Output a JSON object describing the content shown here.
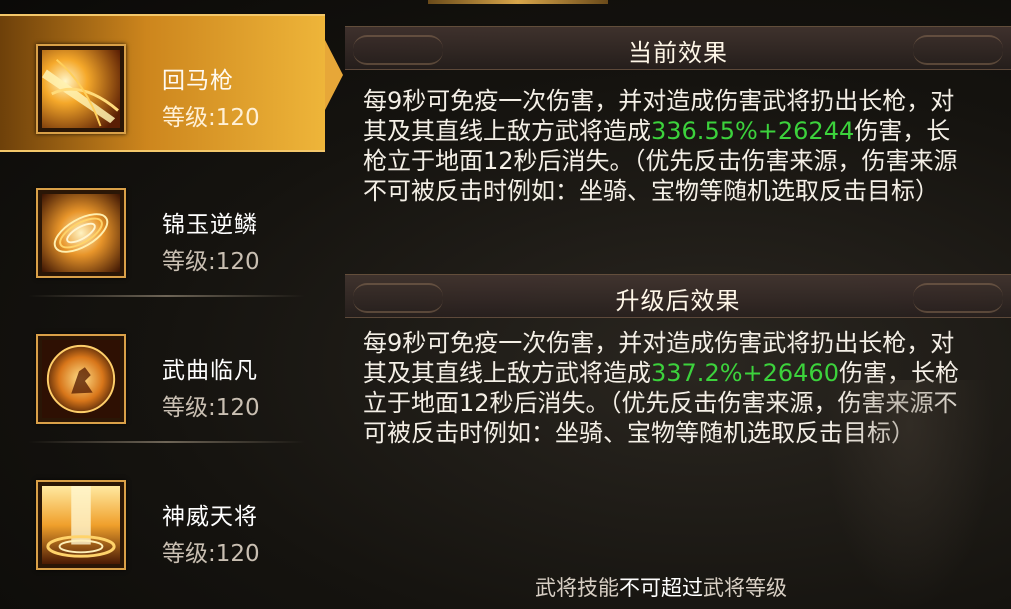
{
  "skills": [
    {
      "name": "回马枪",
      "level": "等级:120",
      "selected": true,
      "icon": "spear-strike-icon"
    },
    {
      "name": "锦玉逆鳞",
      "level": "等级:120",
      "selected": false,
      "icon": "golden-vortex-icon"
    },
    {
      "name": "武曲临凡",
      "level": "等级:120",
      "selected": false,
      "icon": "warrior-orb-icon"
    },
    {
      "name": "神威天将",
      "level": "等级:120",
      "selected": false,
      "icon": "heavenly-pillar-icon"
    }
  ],
  "current": {
    "title": "当前效果",
    "text_before": "每9秒可免疫一次伤害，并对造成伤害武将扔出长枪，对其及其直线上敌方武将造成",
    "highlight": "336.55%+26244",
    "text_after": "伤害，长枪立于地面12秒后消失。（优先反击伤害来源，伤害来源不可被反击时例如：坐骑、宝物等随机选取反击目标）"
  },
  "upgrade": {
    "title": "升级后效果",
    "text_before": "每9秒可免疫一次伤害，并对造成伤害武将扔出长枪，对其及其直线上敌方武将造成",
    "highlight": "337.2%+26460",
    "text_after": "伤害，长枪立于地面12秒后消失。（优先反击伤害来源，伤害来源不可被反击时例如：坐骑、宝物等随机选取反击目标）"
  },
  "footer": {
    "part1": "武将技能",
    "part2": "不可超过",
    "part3": "武将等级"
  },
  "colors": {
    "highlight_green": "#3cd23c",
    "gold_accent": "#e7a738"
  }
}
